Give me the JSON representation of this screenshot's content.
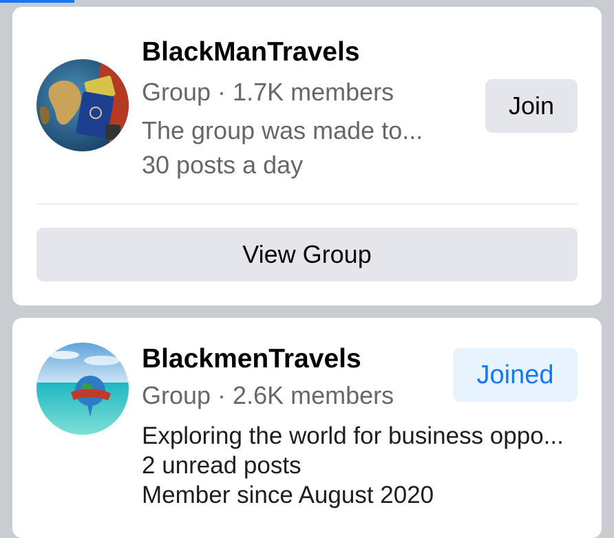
{
  "groups": [
    {
      "name": "BlackManTravels",
      "meta": "Group · 1.7K members",
      "description": "The group was made to...",
      "activity": "30 posts a day",
      "action_label": "Join",
      "view_label": "View Group"
    },
    {
      "name": "BlackmenTravels",
      "meta": "Group · 2.6K members",
      "description": "Exploring the world for business oppo...",
      "unread": "2 unread posts",
      "member_since": "Member since August 2020",
      "action_label": "Joined"
    }
  ],
  "colors": {
    "accent": "#1877f2",
    "joined_bg": "#e7f3ff",
    "button_bg": "#e4e6eb",
    "page_bg": "#c9ccd1"
  }
}
